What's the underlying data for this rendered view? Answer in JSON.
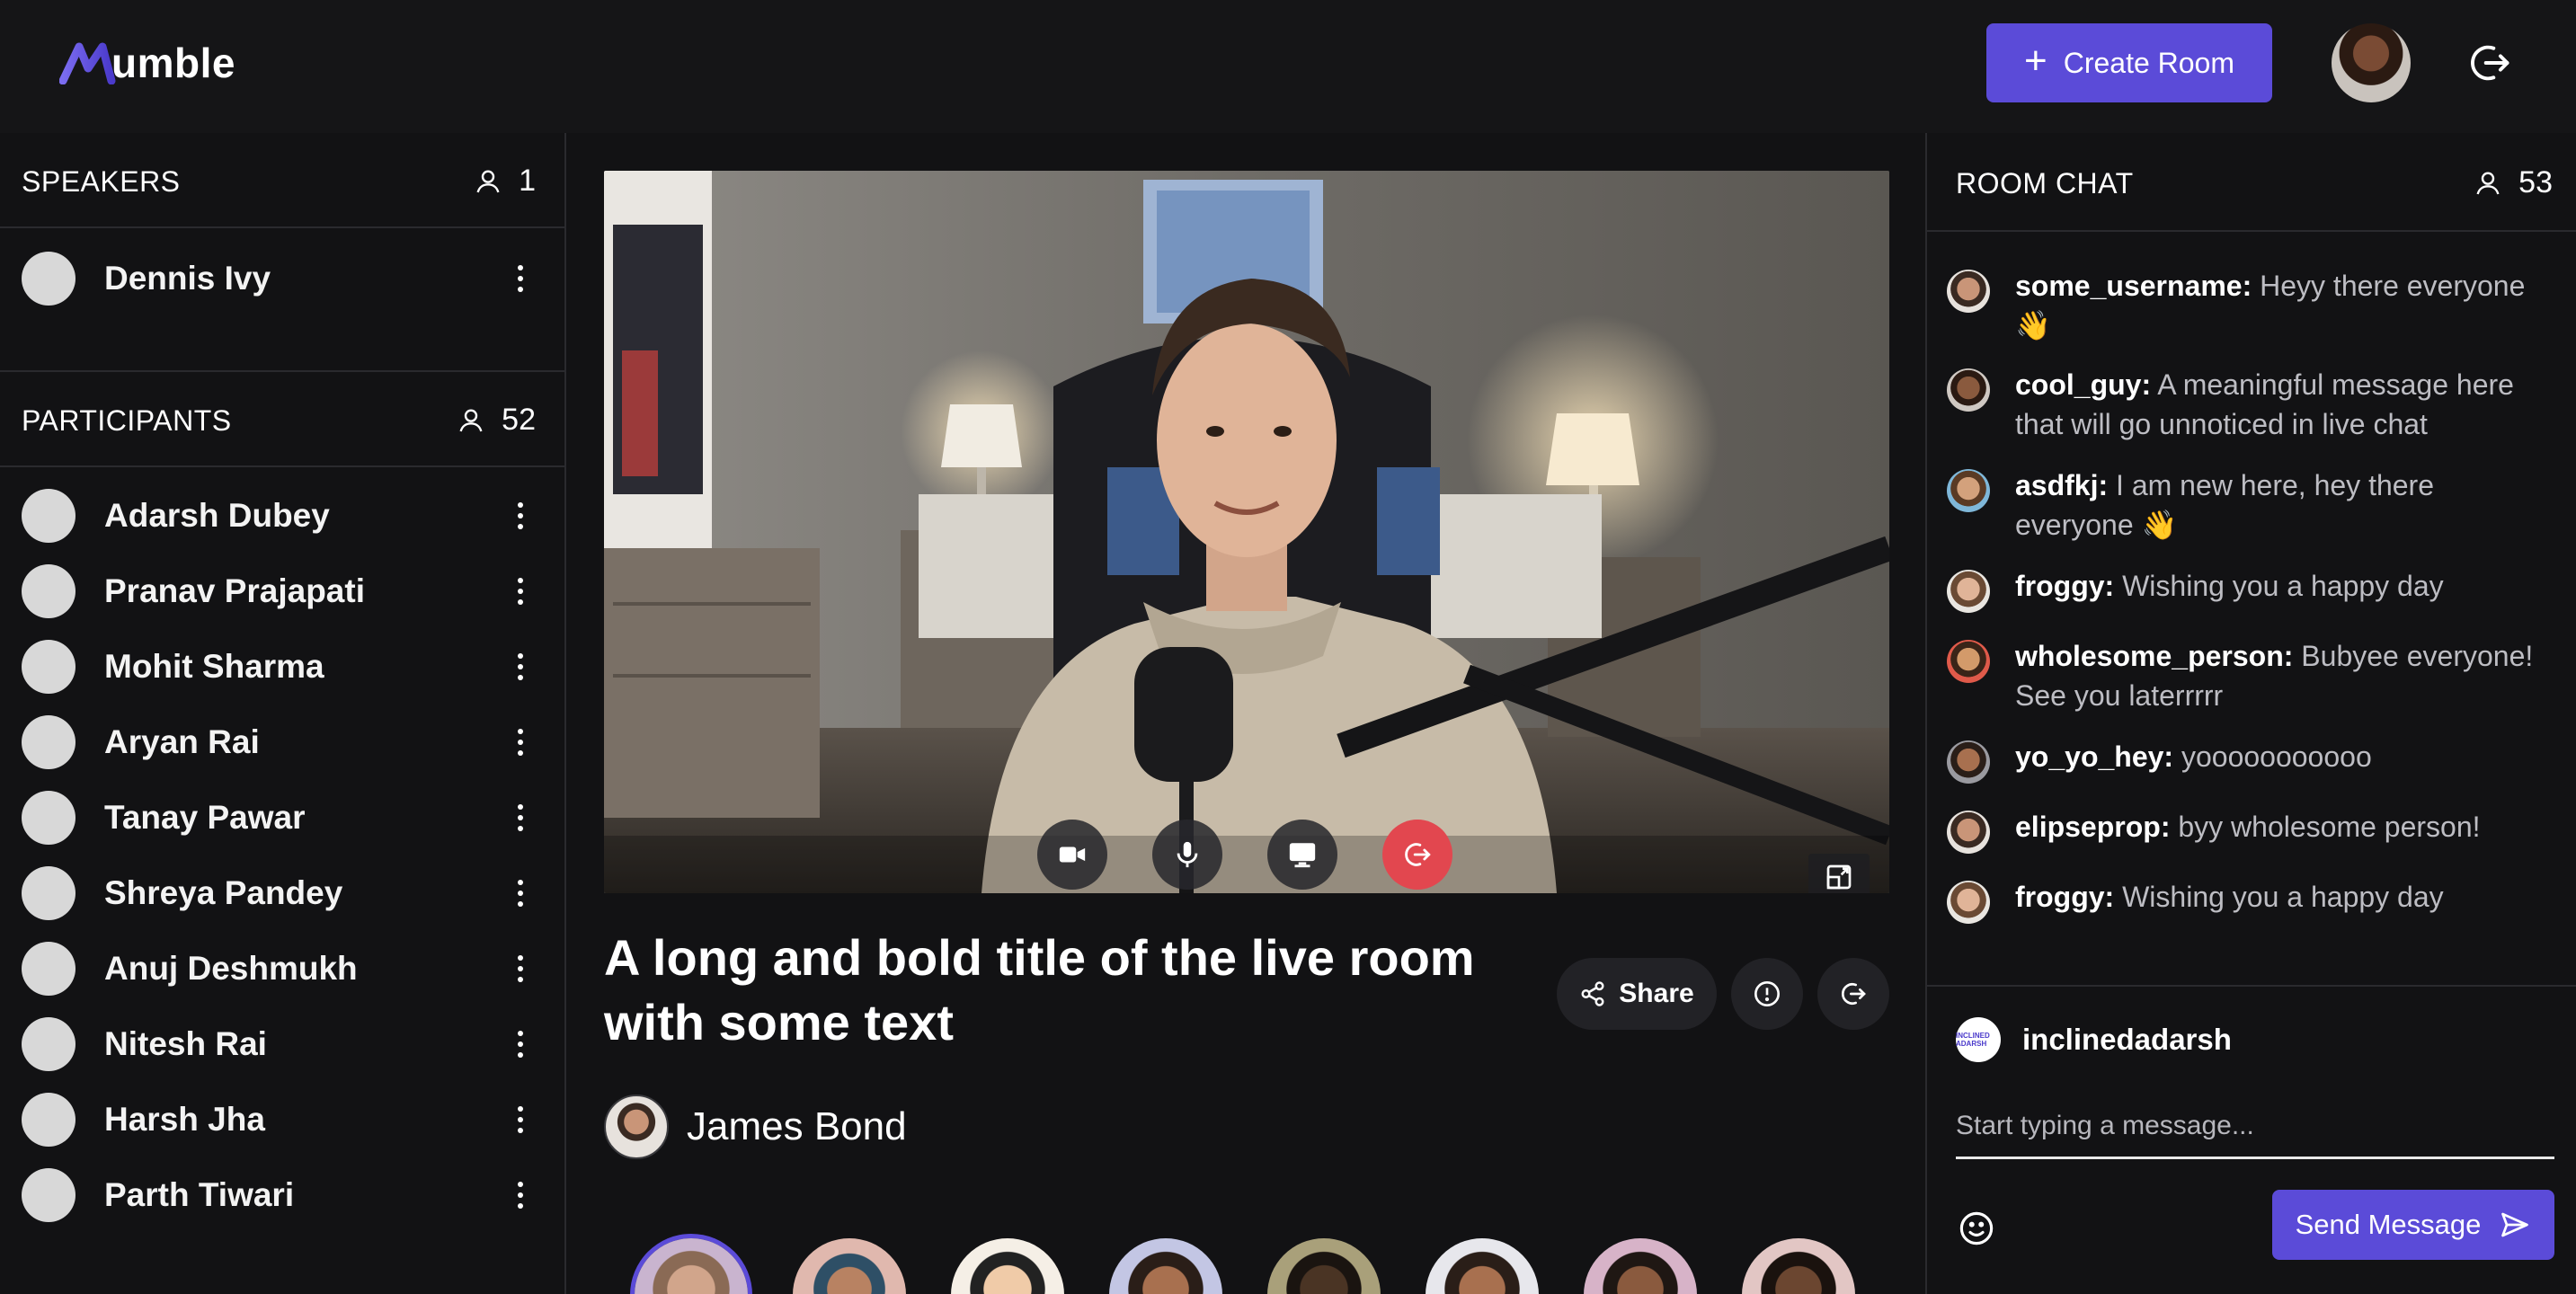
{
  "app": {
    "logo_text": "umble",
    "brand_color": "#5b4bd8"
  },
  "header": {
    "create_room_label": "Create Room",
    "icons": {
      "create": "plus-icon",
      "avatar": "user-avatar",
      "logout": "logout-icon"
    }
  },
  "speakers": {
    "title": "SPEAKERS",
    "count": "1",
    "items": [
      {
        "name": "Dennis Ivy"
      }
    ]
  },
  "participants": {
    "title": "PARTICIPANTS",
    "count": "52",
    "items": [
      {
        "name": "Adarsh Dubey"
      },
      {
        "name": "Pranav Prajapati"
      },
      {
        "name": "Mohit Sharma"
      },
      {
        "name": "Aryan Rai"
      },
      {
        "name": "Tanay Pawar"
      },
      {
        "name": "Shreya Pandey"
      },
      {
        "name": "Anuj Deshmukh"
      },
      {
        "name": "Nitesh Rai"
      },
      {
        "name": "Harsh Jha"
      },
      {
        "name": "Parth Tiwari"
      }
    ]
  },
  "room": {
    "title": "A long and bold title of the live room with some text",
    "share_label": "Share",
    "host_name": "James Bond",
    "video_controls": [
      "camera-icon",
      "microphone-icon",
      "screen-share-icon",
      "leave-call-icon"
    ],
    "leave_color": "#e2474f"
  },
  "chat": {
    "title": "ROOM CHAT",
    "count": "53",
    "messages": [
      {
        "user": "some_username:",
        "text": " Heyy there everyone 👋"
      },
      {
        "user": "cool_guy:",
        "text": " A meaningful message here that will go unnoticed in live chat"
      },
      {
        "user": "asdfkj:",
        "text": " I am new here, hey there everyone 👋"
      },
      {
        "user": "froggy:",
        "text": " Wishing you a happy day"
      },
      {
        "user": "wholesome_person:",
        "text": " Bubyee everyone! See you laterrrrr"
      },
      {
        "user": "yo_yo_hey:",
        "text": " yooooooooooo"
      },
      {
        "user": "elipseprop:",
        "text": " byy wholesome person!"
      },
      {
        "user": "froggy:",
        "text": " Wishing you a happy day"
      }
    ],
    "me": {
      "username": "inclinedadarsh",
      "avatar_text": "INCLINED ADARSH"
    },
    "input_placeholder": "Start typing a message...",
    "send_label": "Send Message"
  }
}
